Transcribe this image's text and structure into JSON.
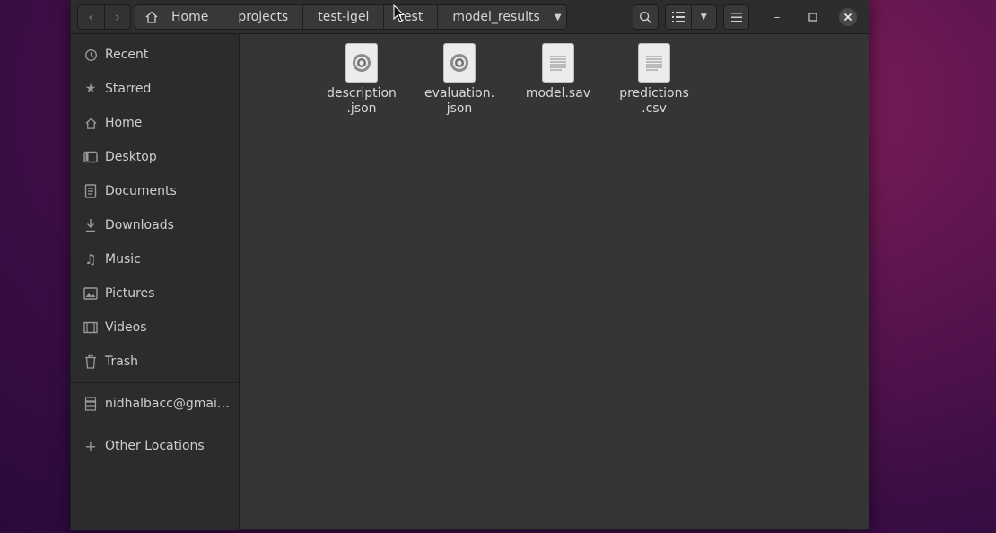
{
  "breadcrumb": {
    "items": [
      "Home",
      "projects",
      "test-igel",
      "test",
      "model_results"
    ]
  },
  "sidebar": {
    "items": [
      {
        "label": "Recent",
        "icon": "clock-icon"
      },
      {
        "label": "Starred",
        "icon": "star-icon"
      },
      {
        "label": "Home",
        "icon": "home-icon"
      },
      {
        "label": "Desktop",
        "icon": "desktop-icon"
      },
      {
        "label": "Documents",
        "icon": "document-icon"
      },
      {
        "label": "Downloads",
        "icon": "download-icon"
      },
      {
        "label": "Music",
        "icon": "music-icon"
      },
      {
        "label": "Pictures",
        "icon": "pictures-icon"
      },
      {
        "label": "Videos",
        "icon": "video-icon"
      },
      {
        "label": "Trash",
        "icon": "trash-icon"
      },
      {
        "label": "nidhalbacc@gmai…",
        "icon": "network-drive-icon"
      },
      {
        "label": "Other Locations",
        "icon": "plus-icon"
      }
    ]
  },
  "files": [
    {
      "name_line1": "description",
      "name_line2": ".json",
      "icon": "json-file-icon"
    },
    {
      "name_line1": "evaluation.",
      "name_line2": "json",
      "icon": "json-file-icon"
    },
    {
      "name_line1": "model.sav",
      "name_line2": "",
      "icon": "text-file-icon"
    },
    {
      "name_line1": "predictions",
      "name_line2": ".csv",
      "icon": "text-file-icon"
    }
  ]
}
